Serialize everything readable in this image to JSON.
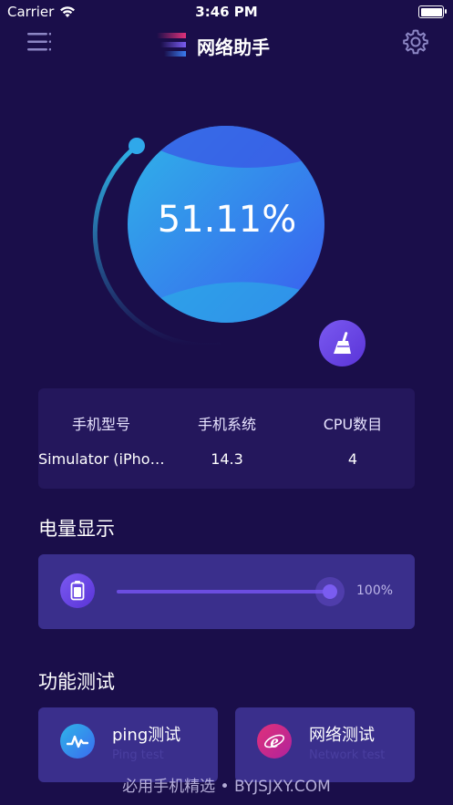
{
  "status_bar": {
    "carrier": "Carrier",
    "time": "3:46 PM"
  },
  "nav": {
    "title": "网络助手"
  },
  "gauge": {
    "percent_text": "51.11%",
    "value": 51.11
  },
  "device_info": {
    "columns": [
      {
        "label": "手机型号",
        "value": "Simulator (iPho…"
      },
      {
        "label": "手机系统",
        "value": "14.3"
      },
      {
        "label": "CPU数目",
        "value": "4"
      }
    ]
  },
  "battery_section": {
    "title": "电量显示",
    "percent_text": "100%",
    "level": 1.0
  },
  "function_section": {
    "title": "功能测试",
    "items": [
      {
        "title": "ping测试",
        "subtitle": "Ping test"
      },
      {
        "title": "网络测试",
        "subtitle": "Network test"
      }
    ]
  },
  "watermark": "必用手机精选 • BYJSJXY.COM",
  "colors": {
    "background": "#1a0e4a",
    "card": "#24175c",
    "accent": "#6b4de0",
    "gauge_start": "#2fb4e8",
    "gauge_end": "#3a5cf0"
  }
}
